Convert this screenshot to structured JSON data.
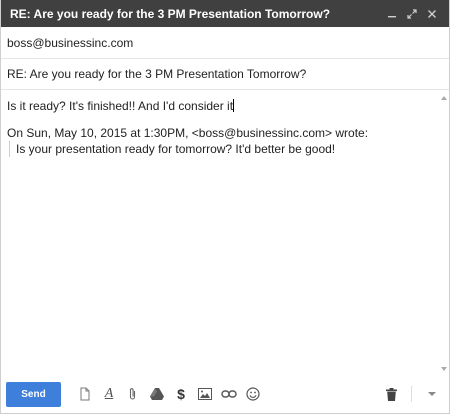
{
  "window": {
    "title": "RE: Are you ready for the 3 PM Presentation Tomorrow?",
    "buttons": [
      "minimize-icon",
      "popout-icon",
      "close-icon"
    ]
  },
  "to": {
    "value": "boss@businessinc.com"
  },
  "subject": {
    "value": "RE: Are you ready for the 3 PM Presentation Tomorrow?"
  },
  "body": {
    "reply": "Is it ready? It's finished!! And I'd consider it",
    "quote_header": "On Sun, May 10, 2015 at 1:30PM, <boss@businessinc.com> wrote:",
    "quote_text": "Is your presentation ready for tomorrow? It'd better be good!"
  },
  "toolbar": {
    "send_label": "Send",
    "format_glyph": "A",
    "money_glyph": "$"
  },
  "colors": {
    "accent": "#3f7fdc",
    "titlebar": "#404040"
  }
}
